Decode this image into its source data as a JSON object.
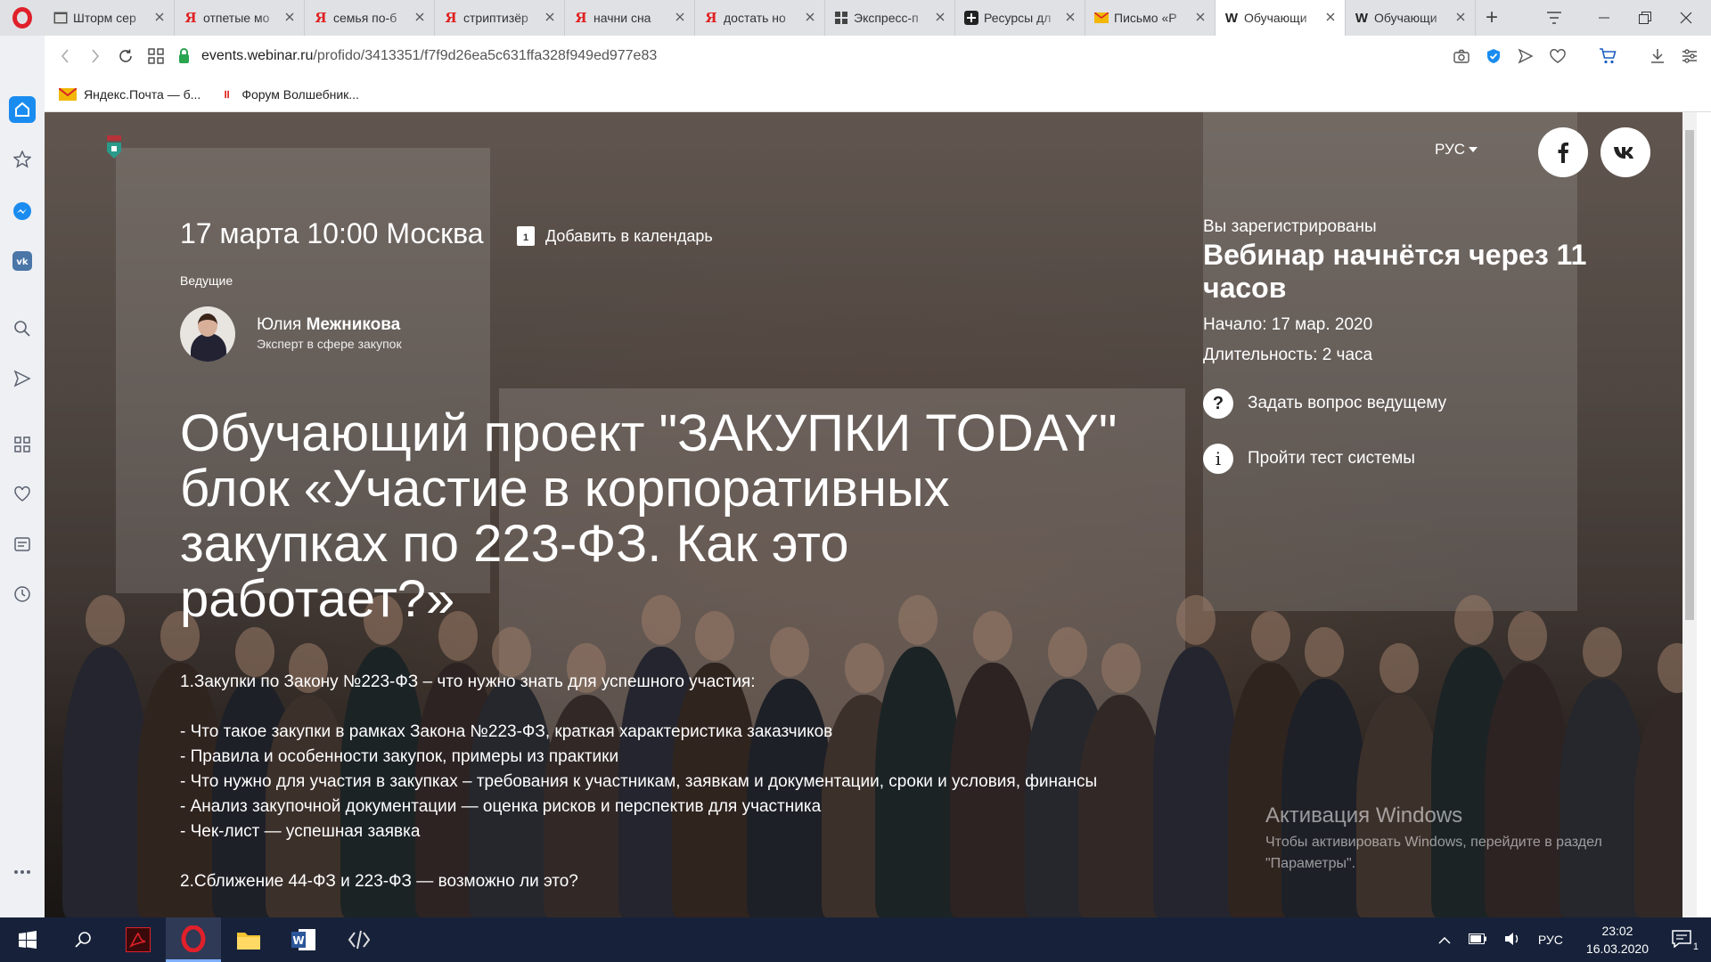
{
  "tabs": [
    {
      "favicon": "window",
      "title": "Шторм сер",
      "active": false
    },
    {
      "favicon": "yandex",
      "title": "отпетые мо",
      "active": false
    },
    {
      "favicon": "yandex",
      "title": "семья по-б",
      "active": false
    },
    {
      "favicon": "yandex",
      "title": "стриптизёр",
      "active": false
    },
    {
      "favicon": "yandex",
      "title": "начни сна",
      "active": false
    },
    {
      "favicon": "yandex",
      "title": "достать но",
      "active": false
    },
    {
      "favicon": "grid",
      "title": "Экспресс-п",
      "active": false
    },
    {
      "favicon": "plus",
      "title": "Ресурсы дл",
      "active": false
    },
    {
      "favicon": "mail",
      "title": "Письмо «Р",
      "active": false
    },
    {
      "favicon": "webinar",
      "title": "Обучающи",
      "active": true
    },
    {
      "favicon": "webinar",
      "title": "Обучающи",
      "active": false
    }
  ],
  "address": {
    "host": "events.webinar.ru",
    "path": "/profido/3413351/f7f9d26ea5c631ffa328f949ed977e83"
  },
  "bookmarks": [
    {
      "label": "Яндекс.Почта — б...",
      "icon": "mail-icon",
      "color": "#f2b705"
    },
    {
      "label": "Форум Волшебник...",
      "icon": "forum-icon",
      "color": "#e4322b"
    }
  ],
  "header": {
    "lang": "РУС",
    "social": [
      "f",
      "vk"
    ]
  },
  "event": {
    "date": "17 марта 10:00 Москва",
    "add_calendar": "Добавить в календарь",
    "calendar_day": "1",
    "hosts_label": "Ведущие",
    "host_first": "Юлия ",
    "host_last": "Межникова",
    "host_role": "Эксперт в сфере закупок",
    "title": "Обучающий проект \"ЗАКУПКИ TODAY\" блок «Участие в корпоративных закупках по 223-ФЗ. Как это работает?»",
    "agenda": [
      "1.Закупки по Закону №223-ФЗ – что нужно знать для успешного участия:",
      "",
      "- Что такое закупки в рамках Закона №223-ФЗ, краткая характеристика заказчиков",
      "- Правила и особенности закупок, примеры из практики",
      "- Что нужно для участия в закупках – требования к участникам, заявкам и документации, сроки и условия, финансы",
      "- Анализ закупочной документации — оценка рисков и перспектив для участника",
      "- Чек-лист — успешная заявка",
      "",
      "2.Сближение 44-ФЗ и 223-ФЗ — возможно ли это?"
    ]
  },
  "registration": {
    "label": "Вы зарегистрированы",
    "title": "Вебинар начнётся через 11 часов",
    "start": "Начало: 17 мар. 2020",
    "duration": "Длительность: 2 часа",
    "ask_question": "Задать вопрос ведущему",
    "system_test": "Пройти тест системы"
  },
  "watermark": {
    "title": "Активация Windows",
    "desc": "Чтобы активировать Windows, перейдите в раздел \"Параметры\"."
  },
  "taskbar": {
    "lang": "РУС",
    "time": "23:02",
    "date": "16.03.2020",
    "notifications": "1"
  },
  "colors": {
    "opera_red": "#e0202a",
    "accent_blue": "#1a8cf0",
    "secure_green": "#2aa44f",
    "taskbar": "#17223a"
  }
}
